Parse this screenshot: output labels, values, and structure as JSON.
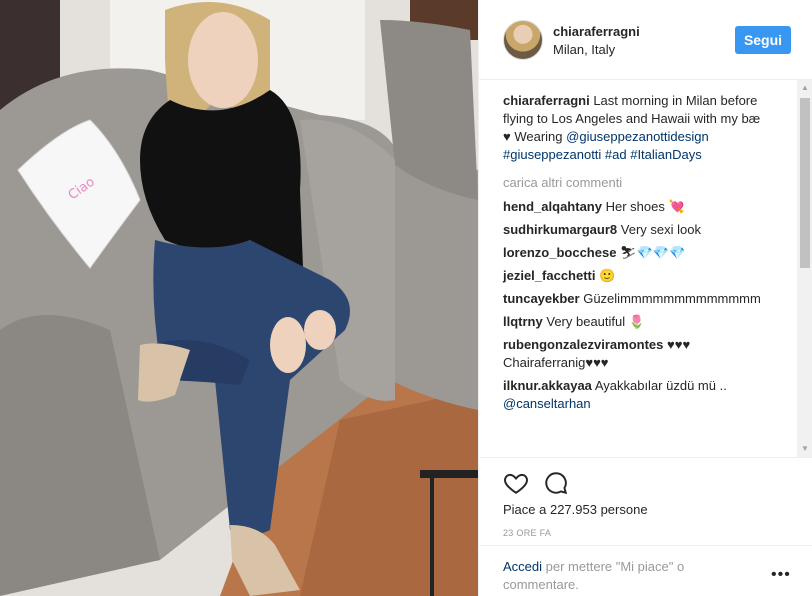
{
  "header": {
    "username": "chiaraferragni",
    "location": "Milan, Italy",
    "follow_label": "Segui"
  },
  "caption": {
    "username": "chiaraferragni",
    "text": "Last morning in Milan before flying to Los Angeles and Hawaii with my bæ ♥ Wearing",
    "tags": "@giuseppezanottidesign #giuseppezanotti #ad #ItalianDays"
  },
  "load_more": "carica altri commenti",
  "comments": [
    {
      "user": "hend_alqahtany",
      "text": "Her shoes 💘"
    },
    {
      "user": "sudhirkumargaur8",
      "text": "Very sexi look"
    },
    {
      "user": "lorenzo_bocchese",
      "text": "⛷💎💎💎"
    },
    {
      "user": "jeziel_facchetti",
      "text": "🙂"
    },
    {
      "user": "tuncayekber",
      "text": "Güzelimmmmmmmmmmmmm"
    },
    {
      "user": "llqtrny",
      "text": "Very beautiful 🌷"
    },
    {
      "user": "rubengonzalezviramontes",
      "text": "♥♥♥ Chairaferranig♥♥♥"
    },
    {
      "user": "ilknur.akkayaa",
      "text": "Ayakkabılar üzdü mü ..",
      "mention": "@canseltarhan"
    }
  ],
  "likes_text": "Piace a 227.953 persone",
  "time_text": "23 ORE FA",
  "add_comment": {
    "login_link": "Accedi",
    "rest": "per mettere \"Mi piace\" o commentare."
  },
  "icons": {
    "like": "heart-icon",
    "comment": "comment-icon",
    "more": "more-options-icon"
  },
  "colors": {
    "accent": "#3897f0",
    "link": "#003569",
    "muted": "#999999"
  }
}
